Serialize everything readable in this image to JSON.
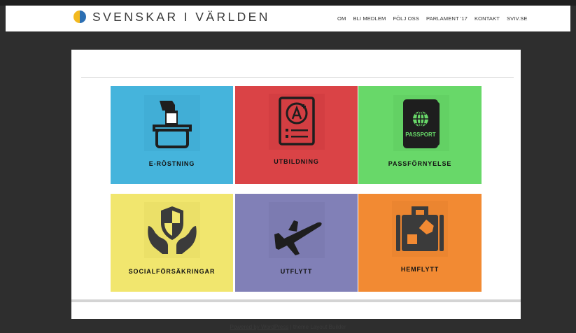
{
  "site": {
    "title": "SVENSKAR I VÄRLDEN",
    "logo_colors": {
      "left": "#f3b91f",
      "right": "#2c6fb3"
    }
  },
  "nav": [
    {
      "label": "OM"
    },
    {
      "label": "BLI MEDLEM"
    },
    {
      "label": "FÖLJ OSS"
    },
    {
      "label": "PARLAMENT '17"
    },
    {
      "label": "KONTAKT"
    },
    {
      "label": "SVIV.SE"
    }
  ],
  "tiles": [
    {
      "label": "E-RÖSTNING",
      "icon": "ballot-box-icon",
      "color": "#45b4dc"
    },
    {
      "label": "UTBILDNING",
      "icon": "grade-paper-icon",
      "color": "#da4346"
    },
    {
      "label": "PASSFÖRNYELSE",
      "icon": "passport-icon",
      "color": "#68d869",
      "icon_text": "PASSPORT"
    },
    {
      "label": "SOCIALFÖRSÄKRINGAR",
      "icon": "shield-hands-icon",
      "color": "#f1e66e"
    },
    {
      "label": "UTFLYTT",
      "icon": "airplane-icon",
      "color": "#8180b7"
    },
    {
      "label": "HEMFLYTT",
      "icon": "suitcase-icon",
      "color": "#f28a33"
    }
  ],
  "footer": {
    "link_text": "Powered by WordPress",
    "separator": " | theme ",
    "theme": "Layout Builder"
  }
}
